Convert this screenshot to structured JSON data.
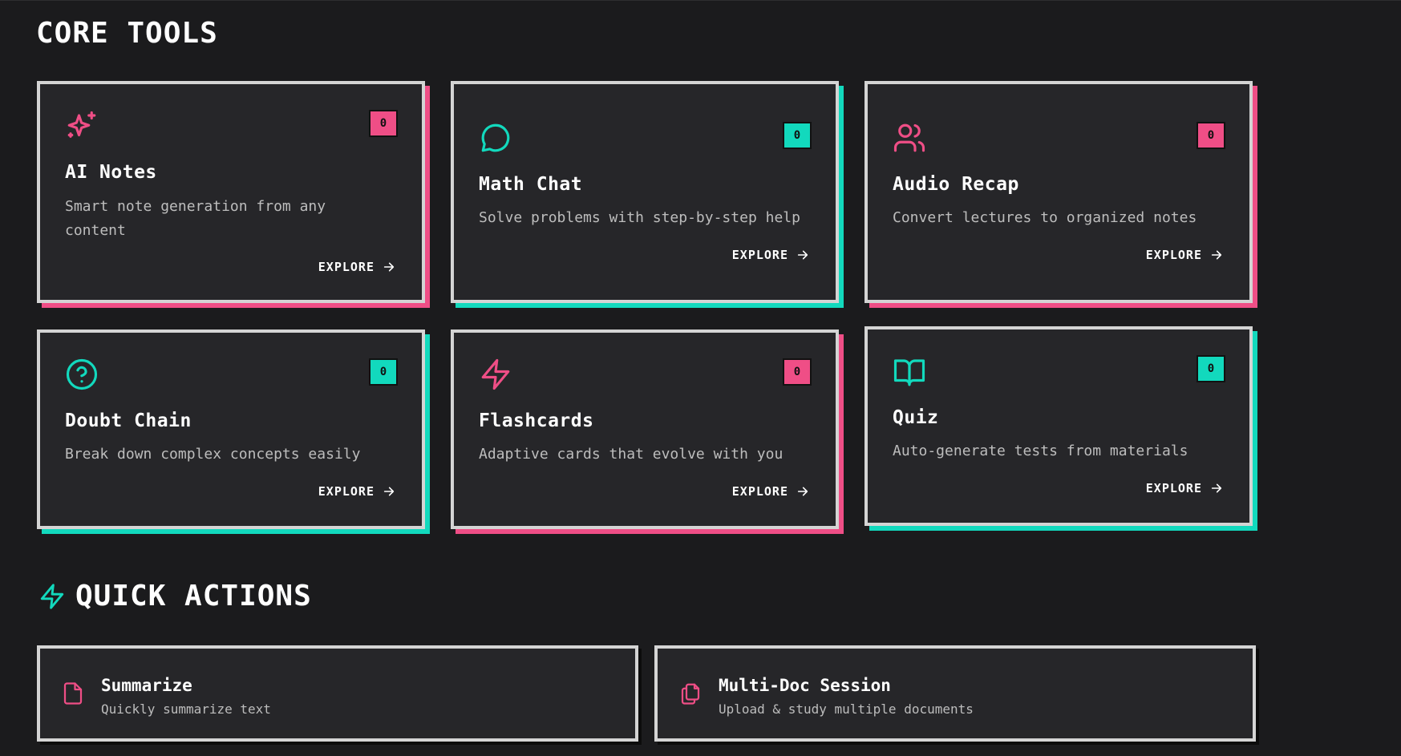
{
  "core_tools": {
    "title": "CORE TOOLS",
    "cards": [
      {
        "title": "AI Notes",
        "description": "Smart note generation from any content",
        "count": "0",
        "cta": "EXPLORE",
        "icon": "sparkles-icon",
        "accent": "#ef4e86"
      },
      {
        "title": "Math Chat",
        "description": "Solve problems with step-by-step help",
        "count": "0",
        "cta": "EXPLORE",
        "icon": "chat-bubble-icon",
        "accent": "#12d9bd"
      },
      {
        "title": "Audio Recap",
        "description": "Convert lectures to organized notes",
        "count": "0",
        "cta": "EXPLORE",
        "icon": "users-icon",
        "accent": "#ef4e86"
      },
      {
        "title": "Doubt Chain",
        "description": "Break down complex concepts easily",
        "count": "0",
        "cta": "EXPLORE",
        "icon": "help-circle-icon",
        "accent": "#12d9bd"
      },
      {
        "title": "Flashcards",
        "description": "Adaptive cards that evolve with you",
        "count": "0",
        "cta": "EXPLORE",
        "icon": "lightning-bolt-icon",
        "accent": "#ef4e86"
      },
      {
        "title": "Quiz",
        "description": "Auto-generate tests from materials",
        "count": "0",
        "cta": "EXPLORE",
        "icon": "open-book-icon",
        "accent": "#12d9bd"
      }
    ]
  },
  "quick_actions": {
    "title": "QUICK ACTIONS",
    "icon": "lightning-bolt-icon",
    "items": [
      {
        "title": "Summarize",
        "subtitle": "Quickly summarize text",
        "icon": "file-icon"
      },
      {
        "title": "Multi-Doc Session",
        "subtitle": "Upload & study multiple documents",
        "icon": "files-icon"
      }
    ]
  },
  "colors": {
    "background": "#1b1b1d",
    "card": "#262629",
    "card_border": "#d4d4d4",
    "pink": "#ef4e86",
    "teal": "#12d9bd",
    "muted_text": "#bdbdbd"
  }
}
